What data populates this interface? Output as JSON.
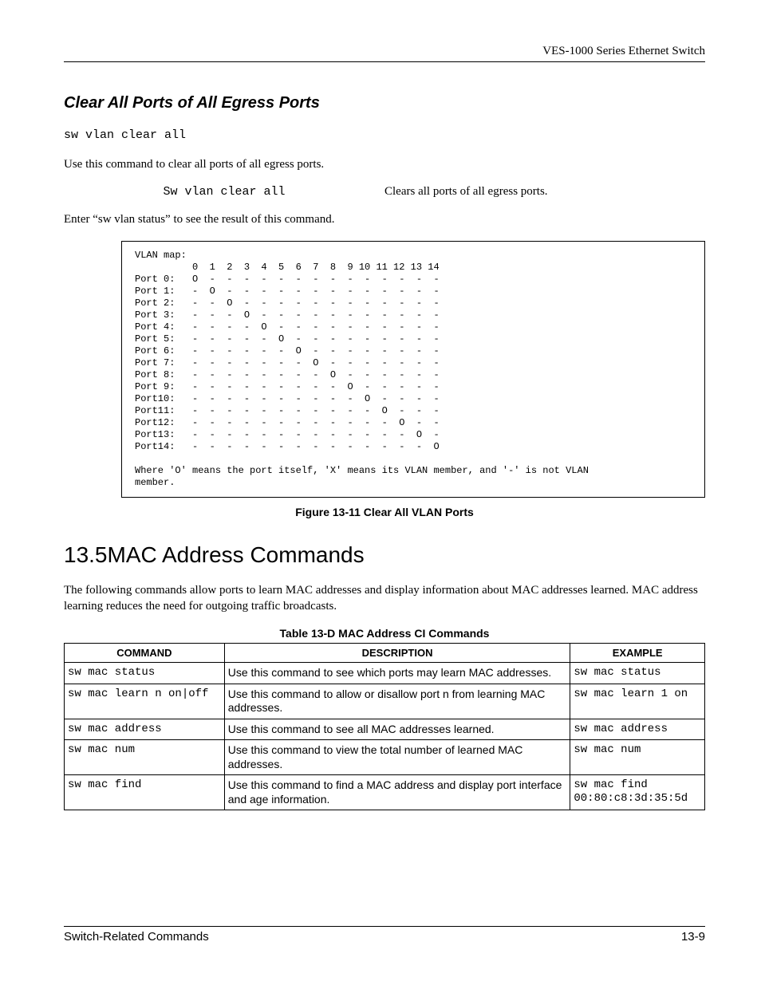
{
  "header": {
    "running_title": "VES-1000 Series Ethernet Switch"
  },
  "section_clear": {
    "heading": "Clear All Ports of All Egress Ports",
    "command": "sw vlan clear all",
    "intro": "Use this command to clear all ports of all egress ports.",
    "example_cmd": "Sw vlan clear all",
    "example_desc": "Clears all ports of all egress ports.",
    "followup": "Enter “sw vlan status” to see the result of this command."
  },
  "terminal": "VLAN map:\n          0  1  2  3  4  5  6  7  8  9 10 11 12 13 14\nPort 0:   O  -  -  -  -  -  -  -  -  -  -  -  -  -  -\nPort 1:   -  O  -  -  -  -  -  -  -  -  -  -  -  -  -\nPort 2:   -  -  O  -  -  -  -  -  -  -  -  -  -  -  -\nPort 3:   -  -  -  O  -  -  -  -  -  -  -  -  -  -  -\nPort 4:   -  -  -  -  O  -  -  -  -  -  -  -  -  -  -\nPort 5:   -  -  -  -  -  O  -  -  -  -  -  -  -  -  -\nPort 6:   -  -  -  -  -  -  O  -  -  -  -  -  -  -  -\nPort 7:   -  -  -  -  -  -  -  O  -  -  -  -  -  -  -\nPort 8:   -  -  -  -  -  -  -  -  O  -  -  -  -  -  -\nPort 9:   -  -  -  -  -  -  -  -  -  O  -  -  -  -  -\nPort10:   -  -  -  -  -  -  -  -  -  -  O  -  -  -  -\nPort11:   -  -  -  -  -  -  -  -  -  -  -  O  -  -  -\nPort12:   -  -  -  -  -  -  -  -  -  -  -  -  O  -  -\nPort13:   -  -  -  -  -  -  -  -  -  -  -  -  -  O  -\nPort14:   -  -  -  -  -  -  -  -  -  -  -  -  -  -  O\n\nWhere 'O' means the port itself, 'X' means its VLAN member, and '-' is not VLAN\nmember.",
  "figure_caption": "Figure 13-11 Clear All VLAN Ports",
  "section_mac": {
    "number": "13.5",
    "title": "MAC Address Commands",
    "intro": "The following commands allow ports to learn MAC addresses and display information about MAC addresses learned. MAC address learning reduces the need for outgoing traffic broadcasts."
  },
  "table": {
    "caption": "Table 13-D MAC Address CI Commands",
    "headers": {
      "c1": "COMMAND",
      "c2": "DESCRIPTION",
      "c3": "EXAMPLE"
    },
    "rows": [
      {
        "cmd": "sw mac status",
        "desc": "Use this command to see which ports may learn MAC addresses.",
        "ex": "sw mac status"
      },
      {
        "cmd": "sw mac learn n on|off",
        "desc": "Use this command to allow or disallow port n from learning MAC addresses.",
        "ex": "sw mac learn 1 on"
      },
      {
        "cmd": "sw mac address",
        "desc": "Use this command to see all MAC addresses learned.",
        "ex": "sw mac address"
      },
      {
        "cmd": "sw mac num",
        "desc": "Use this command to view the total number of learned MAC addresses.",
        "ex": "sw mac num"
      },
      {
        "cmd": "sw mac find",
        "desc": "Use this command to find a MAC address and display port interface and age information.",
        "ex": "sw mac find 00:80:c8:3d:35:5d"
      }
    ]
  },
  "footer": {
    "left": "Switch-Related Commands",
    "right": "13-9"
  }
}
